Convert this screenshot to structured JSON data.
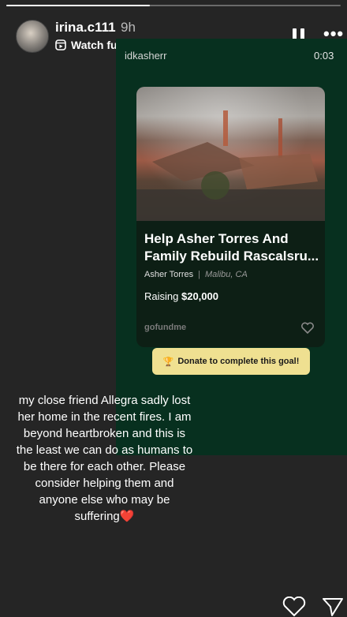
{
  "story": {
    "progress": 0.43
  },
  "header": {
    "username": "irina.c111",
    "time_ago": "9h",
    "watch_label": "Watch full reel",
    "chevron": "›"
  },
  "reel": {
    "username": "idkasherr",
    "timestamp": "0:03"
  },
  "card": {
    "title": "Help Asher Torres And Family Rebuild Rascalsru...",
    "organizer": "Asher Torres",
    "separator": "|",
    "location": "Malibu, CA",
    "raising_label": "Raising",
    "raising_amount": "$20,000",
    "brand": "gofundme"
  },
  "donate": {
    "trophy": "🏆",
    "label": "Donate to complete this goal!"
  },
  "caption": {
    "text": "my close friend Allegra sadly lost her home in the recent fires. I am beyond heartbroken and this is the least we can do as humans to be there for each other. Please consider helping them and anyone else who may be suffering",
    "emoji": "❤️"
  },
  "colors": {
    "reel_background": "#07301f",
    "donate_button": "#efe091",
    "page_background": "#252525"
  },
  "icons": [
    "pause-icon",
    "more-icon",
    "reel-icon",
    "heart-icon",
    "send-icon"
  ]
}
